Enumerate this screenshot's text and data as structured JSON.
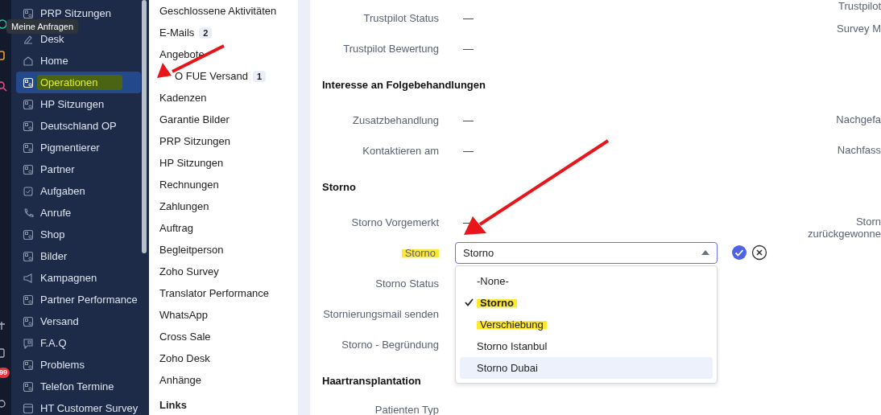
{
  "rail": {
    "badge": "99"
  },
  "tooltip": "Meine Anfragen",
  "sidebar": {
    "items": [
      {
        "label": "PRP Sitzungen",
        "kind": "module",
        "selected": false
      },
      {
        "label": "Desk",
        "kind": "desk",
        "selected": false
      },
      {
        "label": "Home",
        "kind": "home",
        "selected": false
      },
      {
        "label": "Operationen",
        "kind": "module",
        "selected": true,
        "highlighted": true
      },
      {
        "label": "HP Sitzungen",
        "kind": "module",
        "selected": false
      },
      {
        "label": "Deutschland OP",
        "kind": "module",
        "selected": false
      },
      {
        "label": "Pigmentierer",
        "kind": "module",
        "selected": false
      },
      {
        "label": "Partner",
        "kind": "module",
        "selected": false
      },
      {
        "label": "Aufgaben",
        "kind": "task",
        "selected": false
      },
      {
        "label": "Anrufe",
        "kind": "call",
        "selected": false
      },
      {
        "label": "Shop",
        "kind": "module",
        "selected": false
      },
      {
        "label": "Bilder",
        "kind": "module",
        "selected": false
      },
      {
        "label": "Kampagnen",
        "kind": "campaign",
        "selected": false
      },
      {
        "label": "Partner Performance",
        "kind": "module",
        "selected": false
      },
      {
        "label": "Versand",
        "kind": "module",
        "selected": false
      },
      {
        "label": "F.A.Q",
        "kind": "faq",
        "selected": false
      },
      {
        "label": "Problems",
        "kind": "module",
        "selected": false
      },
      {
        "label": "Telefon Termine",
        "kind": "module",
        "selected": false
      },
      {
        "label": "HT Customer Survey",
        "kind": "survey",
        "selected": false
      }
    ]
  },
  "related_list": {
    "items": [
      {
        "label": "Geschlossene Aktivitäten"
      },
      {
        "label": "E-Mails",
        "count": "2"
      },
      {
        "label": "Angebote"
      },
      {
        "label": "O FUE Versand",
        "count": "1"
      },
      {
        "label": "Kadenzen"
      },
      {
        "label": "Garantie Bilder"
      },
      {
        "label": "PRP Sitzungen"
      },
      {
        "label": "HP Sitzungen"
      },
      {
        "label": "Rechnungen"
      },
      {
        "label": "Zahlungen"
      },
      {
        "label": "Auftrag"
      },
      {
        "label": "Begleitperson"
      },
      {
        "label": "Zoho Survey"
      },
      {
        "label": "Translator Performance"
      },
      {
        "label": "WhatsApp"
      },
      {
        "label": "Cross Sale"
      },
      {
        "label": "Zoho Desk"
      },
      {
        "label": "Anhänge"
      }
    ],
    "links_heading": "Links"
  },
  "details": {
    "rows": [
      {
        "kind": "field",
        "label": "Trustpilot Status",
        "value": "—"
      },
      {
        "kind": "field",
        "label": "Trustpilot Bewertung",
        "value": "—"
      },
      {
        "kind": "heading",
        "title": "Interesse an Folgebehandlungen"
      },
      {
        "kind": "field",
        "label": "Zusatzbehandlung",
        "value": "—"
      },
      {
        "kind": "field",
        "label": "Kontaktieren am",
        "value": "—"
      },
      {
        "kind": "heading",
        "title": "Storno"
      },
      {
        "kind": "field",
        "label": "Storno Vorgemerkt",
        "value": "—"
      },
      {
        "kind": "select",
        "label": "Storno",
        "label_highlighted": true,
        "value": "Storno",
        "expanded": true,
        "options": [
          {
            "label": "-None-",
            "selected": false,
            "hovered": false,
            "highlighted": false
          },
          {
            "label": "Storno",
            "selected": true,
            "hovered": false,
            "highlighted": true
          },
          {
            "label": "Verschiebung",
            "selected": false,
            "hovered": false,
            "highlighted": true
          },
          {
            "label": "Storno Istanbul",
            "selected": false,
            "hovered": false,
            "highlighted": false
          },
          {
            "label": "Storno Dubai",
            "selected": false,
            "hovered": true,
            "highlighted": false
          }
        ]
      },
      {
        "kind": "field",
        "label": "Storno Status"
      },
      {
        "kind": "field",
        "label": "Stornierungsmail senden"
      },
      {
        "kind": "field",
        "label": "Storno - Begründung"
      },
      {
        "kind": "heading",
        "title": "Haartransplantation"
      },
      {
        "kind": "field",
        "label": "Patienten Typ"
      }
    ],
    "right_labels": [
      "Trustpilot",
      "Survey M",
      "Nachgefa",
      "Nachfass",
      "Storn\nzurückgewonne"
    ]
  }
}
